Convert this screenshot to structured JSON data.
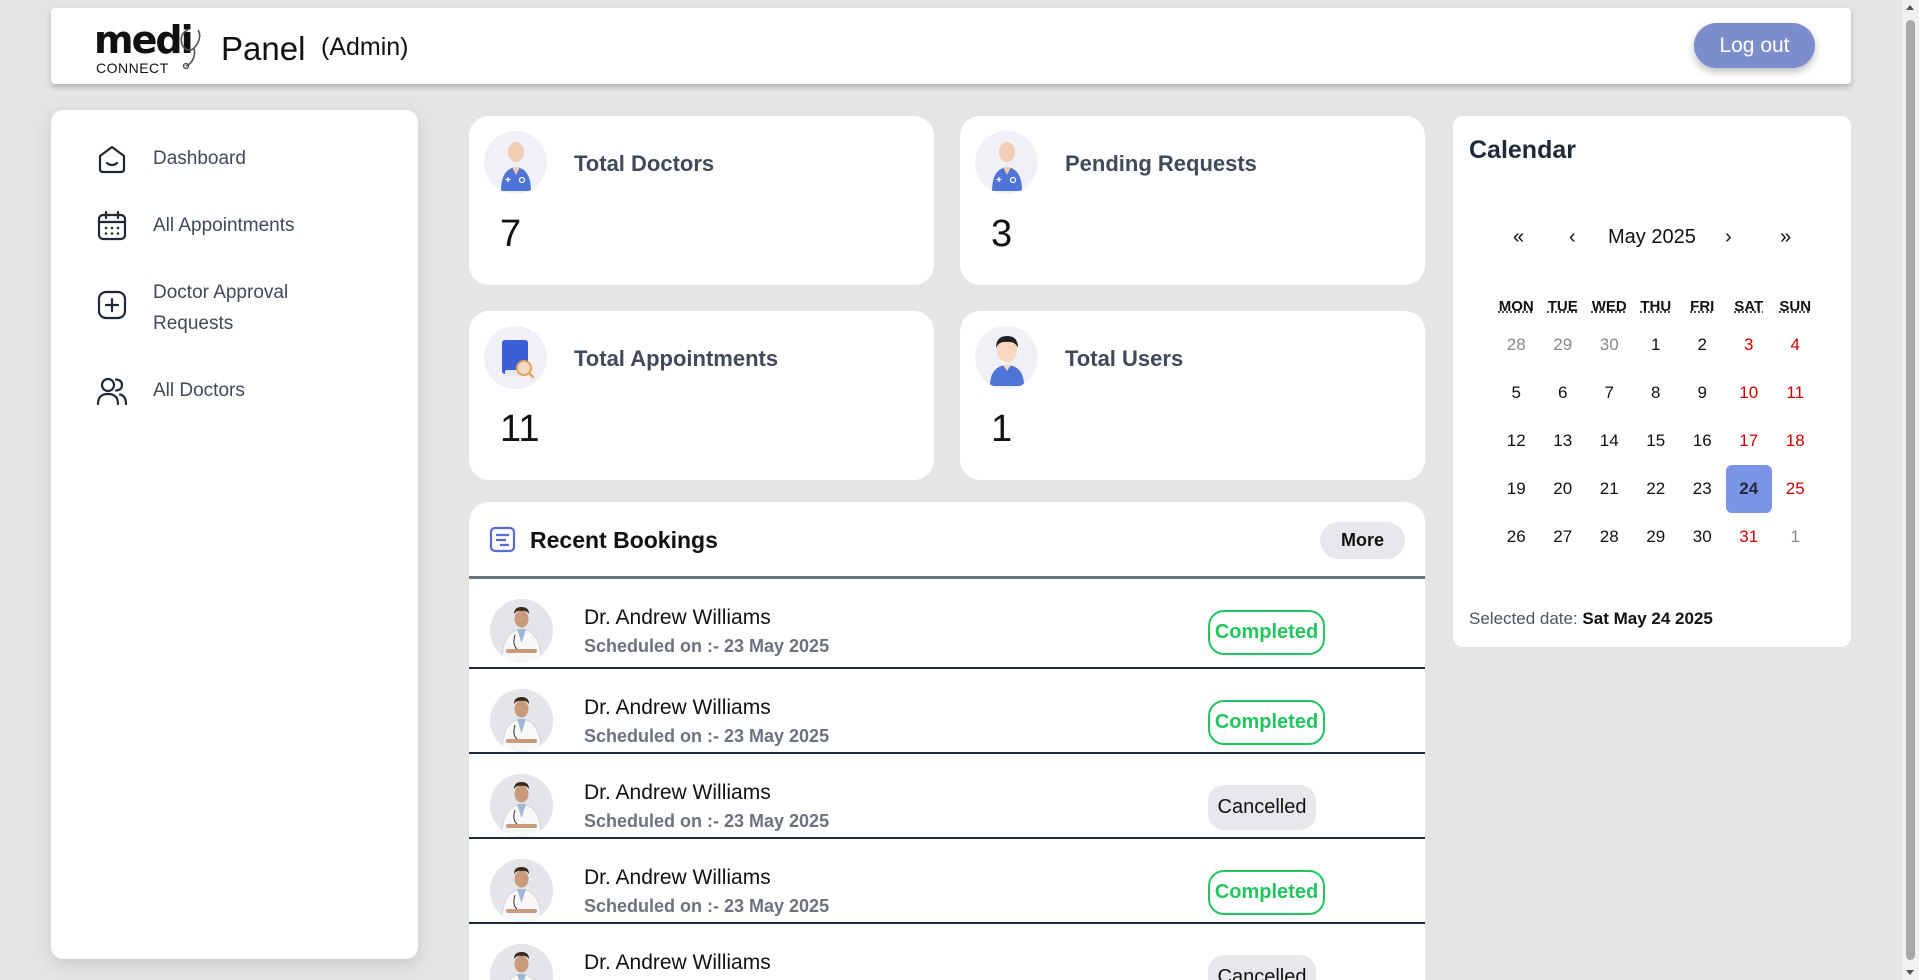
{
  "header": {
    "logo_medi": "medi",
    "logo_connect": "CONNECT",
    "logo_panel": "Panel",
    "role": "(Admin)",
    "logout_label": "Log out"
  },
  "sidebar": {
    "items": [
      {
        "label": "Dashboard",
        "icon": "home-icon"
      },
      {
        "label": "All Appointments",
        "icon": "calendar-icon"
      },
      {
        "label": "Doctor Approval Requests",
        "icon": "plus-square-icon"
      },
      {
        "label": "All Doctors",
        "icon": "users-icon"
      }
    ]
  },
  "stats": [
    {
      "title": "Total Doctors",
      "value": "7",
      "icon": "doctor-avatar-icon"
    },
    {
      "title": "Pending Requests",
      "value": "3",
      "icon": "doctor-avatar-icon"
    },
    {
      "title": "Total Appointments",
      "value": "11",
      "icon": "appointment-book-icon"
    },
    {
      "title": "Total Users",
      "value": "1",
      "icon": "user-avatar-icon"
    }
  ],
  "bookings": {
    "title": "Recent Bookings",
    "more_label": "More",
    "rows": [
      {
        "name": "Dr. Andrew Williams",
        "date": "Scheduled on :- 23 May 2025",
        "status": "Completed"
      },
      {
        "name": "Dr. Andrew Williams",
        "date": "Scheduled on :- 23 May 2025",
        "status": "Completed"
      },
      {
        "name": "Dr. Andrew Williams",
        "date": "Scheduled on :- 23 May 2025",
        "status": "Cancelled"
      },
      {
        "name": "Dr. Andrew Williams",
        "date": "Scheduled on :- 23 May 2025",
        "status": "Completed"
      },
      {
        "name": "Dr. Andrew Williams",
        "date": "",
        "status": "Cancelled"
      }
    ]
  },
  "calendar": {
    "title": "Calendar",
    "nav": {
      "prev_year": "«",
      "prev_month": "‹",
      "month_label": "May 2025",
      "next_month": "›",
      "next_year": "»"
    },
    "weekdays": [
      "MON",
      "TUE",
      "WED",
      "THU",
      "FRI",
      "SAT",
      "SUN"
    ],
    "weeks": [
      [
        "28",
        "29",
        "30",
        "1",
        "2",
        "3",
        "4"
      ],
      [
        "5",
        "6",
        "7",
        "8",
        "9",
        "10",
        "11"
      ],
      [
        "12",
        "13",
        "14",
        "15",
        "16",
        "17",
        "18"
      ],
      [
        "19",
        "20",
        "21",
        "22",
        "23",
        "24",
        "25"
      ],
      [
        "26",
        "27",
        "28",
        "29",
        "30",
        "31",
        "1"
      ]
    ],
    "selected_day": "24",
    "selected_label": "Selected date: ",
    "selected_value": "Sat May 24 2025"
  },
  "colors": {
    "accent": "#7b8dcc",
    "completed": "#22c55e",
    "weekend": "#d10000",
    "selected": "#7b94e6"
  }
}
